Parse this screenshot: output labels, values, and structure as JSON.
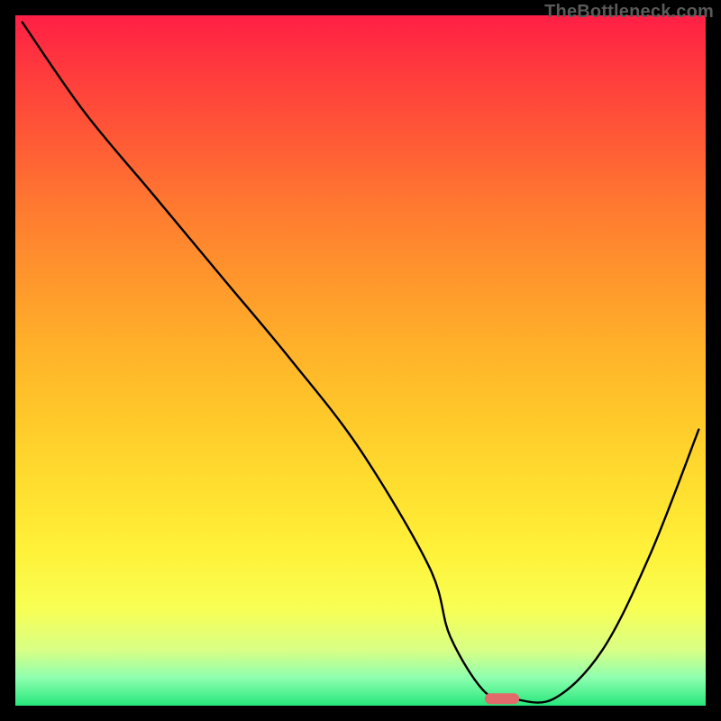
{
  "watermark": "TheBottleneck.com",
  "chart_data": {
    "type": "line",
    "title": "",
    "xlabel": "",
    "ylabel": "",
    "xlim": [
      0,
      100
    ],
    "ylim": [
      0,
      100
    ],
    "grid": false,
    "legend": false,
    "background_gradient": {
      "direction": "vertical",
      "top_color": "#ff1f45",
      "mid_color": "#ffd92f",
      "bottom_color": "#26e77a"
    },
    "series": [
      {
        "name": "bottleneck-curve",
        "x": [
          1,
          10,
          20,
          30,
          40,
          50,
          60,
          63,
          68,
          72,
          78,
          85,
          92,
          99
        ],
        "y": [
          99,
          86,
          74,
          62,
          50,
          37,
          20,
          10,
          2,
          1,
          1,
          8,
          22,
          40
        ]
      }
    ],
    "highlight_marker": {
      "x_range": [
        68,
        73
      ],
      "y": 1,
      "color": "#e26a6a"
    }
  }
}
